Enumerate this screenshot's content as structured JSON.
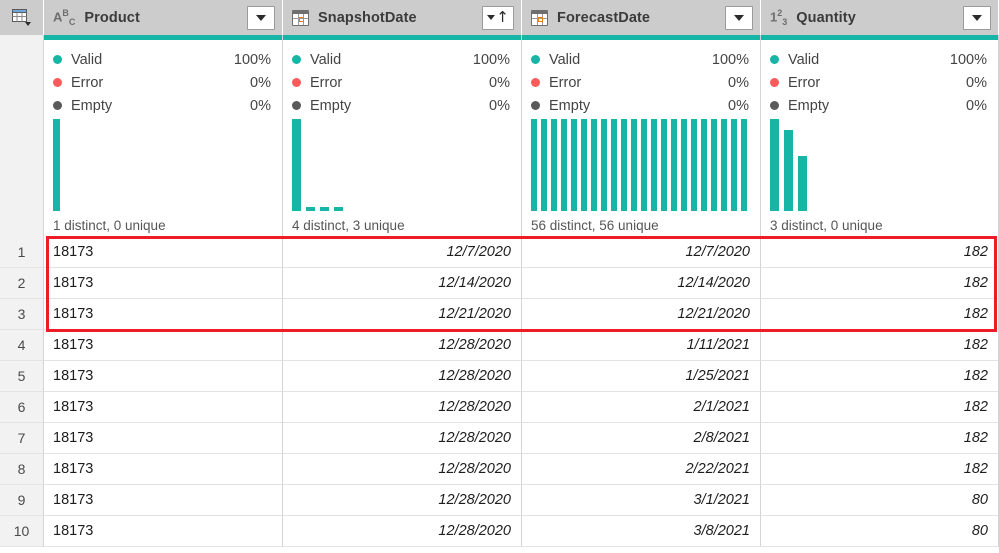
{
  "colors": {
    "accent_teal": "#16b5a6",
    "valid_dot": "#16b5a6",
    "error_dot": "#fa5a5a",
    "empty_dot": "#5a5a5a",
    "highlight_red": "#ee1c25",
    "header_bg": "#cccccc"
  },
  "corner": {
    "icon": "table-select-icon",
    "dropdown": "chevron-down-icon"
  },
  "columns": [
    {
      "name": "Product",
      "type_icon": "abc-text-type-icon",
      "type_label": "ABC",
      "menu_icon": "chevron-down-icon",
      "sorted": false,
      "align": "left",
      "quality": [
        {
          "label": "Valid",
          "value": "100%",
          "dot": "valid"
        },
        {
          "label": "Error",
          "value": "0%",
          "dot": "error"
        },
        {
          "label": "Empty",
          "value": "0%",
          "dot": "empty"
        }
      ],
      "histogram": [
        100
      ],
      "footer": "1 distinct, 0 unique"
    },
    {
      "name": "SnapshotDate",
      "type_icon": "calendar-date-type-icon",
      "type_label": "",
      "menu_icon": "sort-ascending-icon",
      "sorted": true,
      "align": "right",
      "quality": [
        {
          "label": "Valid",
          "value": "100%",
          "dot": "valid"
        },
        {
          "label": "Error",
          "value": "0%",
          "dot": "error"
        },
        {
          "label": "Empty",
          "value": "0%",
          "dot": "empty"
        }
      ],
      "histogram": [
        100,
        4,
        4,
        4
      ],
      "footer": "4 distinct, 3 unique"
    },
    {
      "name": "ForecastDate",
      "type_icon": "calendar-date-type-icon",
      "type_label": "",
      "menu_icon": "chevron-down-icon",
      "sorted": false,
      "align": "right",
      "quality": [
        {
          "label": "Valid",
          "value": "100%",
          "dot": "valid"
        },
        {
          "label": "Error",
          "value": "0%",
          "dot": "error"
        },
        {
          "label": "Empty",
          "value": "0%",
          "dot": "empty"
        }
      ],
      "histogram": [
        100,
        100,
        100,
        100,
        100,
        100,
        100,
        100,
        100,
        100,
        100,
        100,
        100,
        100,
        100,
        100,
        100,
        100,
        100,
        100,
        100,
        100
      ],
      "footer": "56 distinct, 56 unique"
    },
    {
      "name": "Quantity",
      "type_icon": "123-number-type-icon",
      "type_label": "123",
      "menu_icon": "chevron-down-icon",
      "sorted": false,
      "align": "right",
      "quality": [
        {
          "label": "Valid",
          "value": "100%",
          "dot": "valid"
        },
        {
          "label": "Error",
          "value": "0%",
          "dot": "error"
        },
        {
          "label": "Empty",
          "value": "0%",
          "dot": "empty"
        }
      ],
      "histogram": [
        100,
        88,
        60
      ],
      "footer": "3 distinct, 0 unique"
    }
  ],
  "rows": [
    {
      "num": "1",
      "Product": "18173",
      "SnapshotDate": "12/7/2020",
      "ForecastDate": "12/7/2020",
      "Quantity": "182"
    },
    {
      "num": "2",
      "Product": "18173",
      "SnapshotDate": "12/14/2020",
      "ForecastDate": "12/14/2020",
      "Quantity": "182"
    },
    {
      "num": "3",
      "Product": "18173",
      "SnapshotDate": "12/21/2020",
      "ForecastDate": "12/21/2020",
      "Quantity": "182"
    },
    {
      "num": "4",
      "Product": "18173",
      "SnapshotDate": "12/28/2020",
      "ForecastDate": "1/11/2021",
      "Quantity": "182"
    },
    {
      "num": "5",
      "Product": "18173",
      "SnapshotDate": "12/28/2020",
      "ForecastDate": "1/25/2021",
      "Quantity": "182"
    },
    {
      "num": "6",
      "Product": "18173",
      "SnapshotDate": "12/28/2020",
      "ForecastDate": "2/1/2021",
      "Quantity": "182"
    },
    {
      "num": "7",
      "Product": "18173",
      "SnapshotDate": "12/28/2020",
      "ForecastDate": "2/8/2021",
      "Quantity": "182"
    },
    {
      "num": "8",
      "Product": "18173",
      "SnapshotDate": "12/28/2020",
      "ForecastDate": "2/22/2021",
      "Quantity": "182"
    },
    {
      "num": "9",
      "Product": "18173",
      "SnapshotDate": "12/28/2020",
      "ForecastDate": "3/1/2021",
      "Quantity": "80"
    },
    {
      "num": "10",
      "Product": "18173",
      "SnapshotDate": "12/28/2020",
      "ForecastDate": "3/8/2021",
      "Quantity": "80"
    }
  ],
  "highlight": {
    "from_row": 1,
    "to_row": 3,
    "label": "highlighted-rows-annotation"
  }
}
